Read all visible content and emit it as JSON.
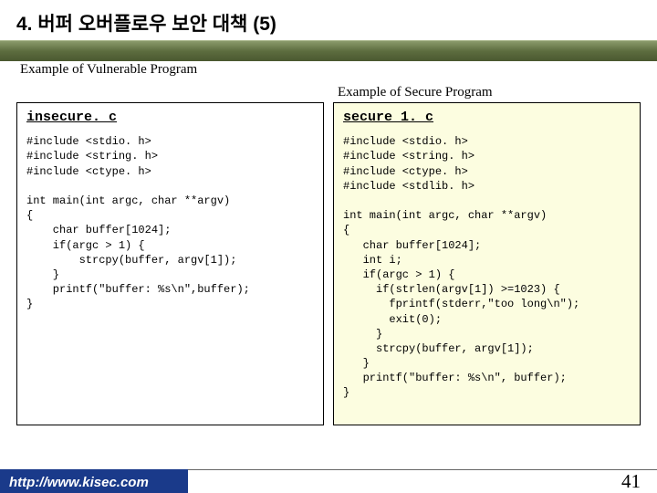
{
  "title": "4. 버퍼 오버플로우 보안 대책 (5)",
  "label_left": "Example of Vulnerable Program",
  "label_right": "Example of Secure Program",
  "left": {
    "filename": "insecure. c",
    "code": "#include <stdio. h>\n#include <string. h>\n#include <ctype. h>\n\nint main(int argc, char **argv)\n{\n    char buffer[1024];\n    if(argc > 1) {\n        strcpy(buffer, argv[1]);\n    }\n    printf(\"buffer: %s\\n\",buffer);\n}"
  },
  "right": {
    "filename": "secure 1. c",
    "code": "#include <stdio. h>\n#include <string. h>\n#include <ctype. h>\n#include <stdlib. h>\n\nint main(int argc, char **argv)\n{\n   char buffer[1024];\n   int i;\n   if(argc > 1) {\n     if(strlen(argv[1]) >=1023) {\n       fprintf(stderr,\"too long\\n\");\n       exit(0);\n     }\n     strcpy(buffer, argv[1]);\n   }\n   printf(\"buffer: %s\\n\", buffer);\n}"
  },
  "footer": {
    "url": "http://www.kisec.com",
    "page": "41"
  }
}
